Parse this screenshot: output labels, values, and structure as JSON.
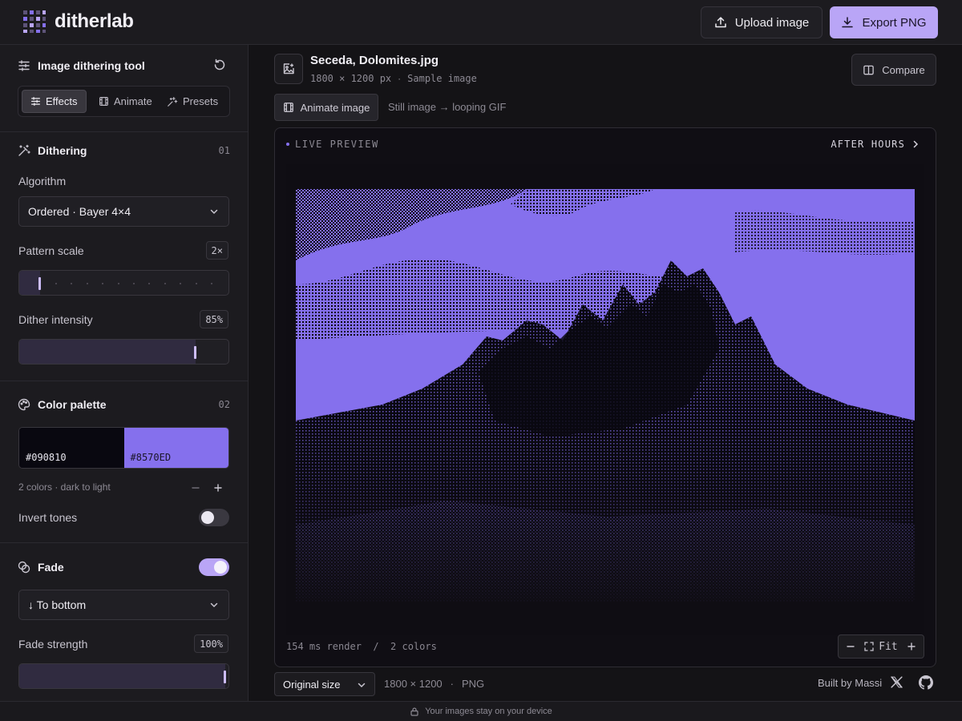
{
  "header": {
    "app_name": "ditherlab",
    "upload_label": "Upload image",
    "export_label": "Export PNG"
  },
  "sidebar": {
    "title": "Image dithering tool",
    "tabs": [
      {
        "label": "Effects",
        "icon": "sliders-icon",
        "active": true
      },
      {
        "label": "Animate",
        "icon": "film-icon",
        "active": false
      },
      {
        "label": "Presets",
        "icon": "sparkles-icon",
        "active": false
      }
    ],
    "dithering": {
      "title": "Dithering",
      "number": "01",
      "algorithm_label": "Algorithm",
      "algorithm_value": "Ordered · Bayer 4×4",
      "pattern_scale_label": "Pattern scale",
      "pattern_scale_value": "2×",
      "pattern_scale_fraction": 0.1,
      "intensity_label": "Dither intensity",
      "intensity_value": "85%",
      "intensity_fraction": 0.85
    },
    "palette": {
      "title": "Color palette",
      "number": "02",
      "colors": [
        "#090810",
        "#8570ED"
      ],
      "summary": "2 colors · dark to light",
      "invert_label": "Invert tones",
      "invert_on": false
    },
    "fade": {
      "title": "Fade",
      "enabled": true,
      "direction_value": "↓ To bottom",
      "strength_label": "Fade strength",
      "strength_value": "100%",
      "strength_fraction": 1.0
    }
  },
  "main": {
    "file_name": "Seceda, Dolomites.jpg",
    "file_dims": "1800 × 1200 px",
    "file_sep": "·",
    "file_source": "Sample image",
    "compare_label": "Compare",
    "animate_label": "Animate image",
    "animate_hint": "Still image → looping GIF",
    "preview": {
      "live_label": "LIVE PREVIEW",
      "preset_label": "AFTER HOURS",
      "render_stats": "154 ms render  /  2 colors",
      "zoom_fit": "Fit"
    },
    "output": {
      "size_value": "Original size",
      "dims": "1800 × 1200",
      "sep": "·",
      "format": "PNG",
      "credit": "Built by Massi"
    }
  },
  "footer": {
    "privacy_text": "Your images stay on your device"
  },
  "colors": {
    "accent": "#b9a5f6",
    "dither_dark": "#090810",
    "dither_light": "#8570ED"
  }
}
